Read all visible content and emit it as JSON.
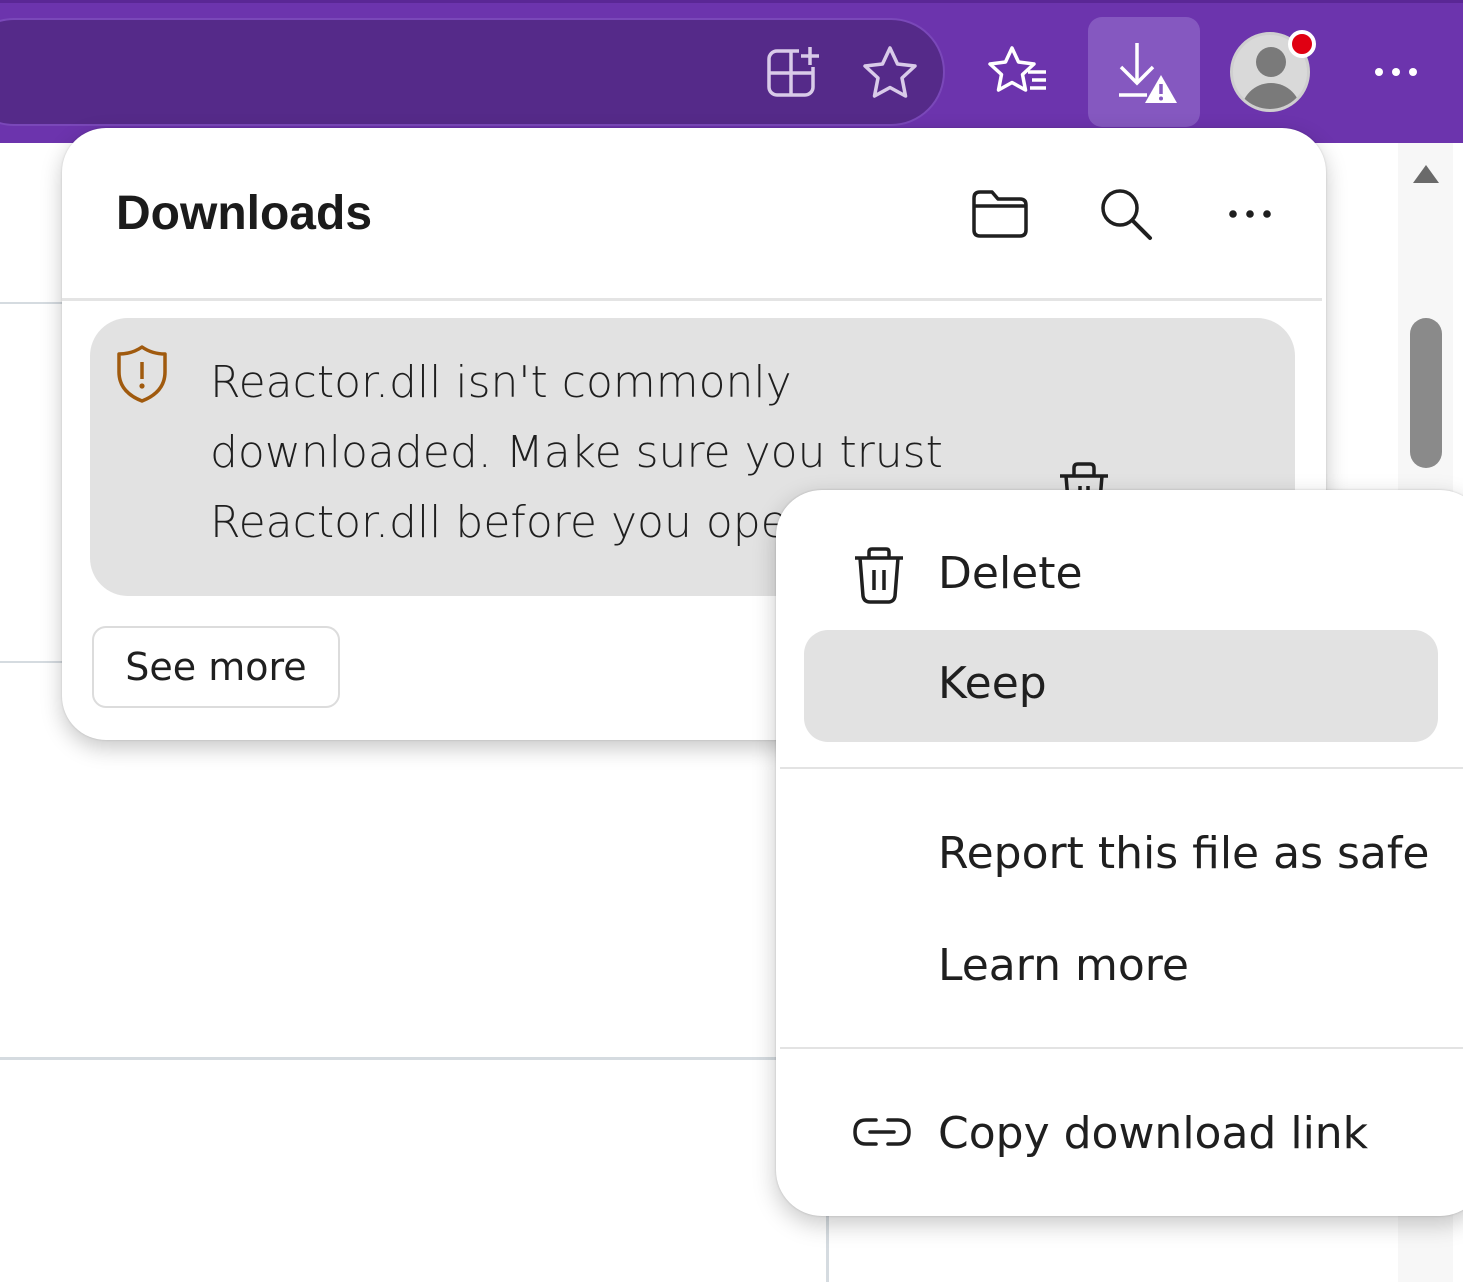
{
  "toolbar": {
    "address_icons": [
      "add-split-tab-icon",
      "favorite-star-icon"
    ],
    "favorites_icon": "favorites-list-icon",
    "downloads_icon": "download-warning-icon",
    "more_icon": "more-horizontal-icon",
    "colors": {
      "background": "#6c34ad",
      "address_bar": "#552a89",
      "active_button": "#8558c0"
    }
  },
  "downloads_panel": {
    "title": "Downloads",
    "header_icons": [
      "open-folder-icon",
      "search-icon",
      "more-horizontal-icon"
    ],
    "warning": {
      "icon": "shield-warning-icon",
      "line1": "Reactor.dll isn't commonly",
      "line2": "downloaded. Make sure you trust",
      "line3": "Reactor.dll before you ope"
    },
    "see_more_label": "See more"
  },
  "context_menu": {
    "items": [
      {
        "label": "Delete",
        "icon": "trash-icon"
      },
      {
        "label": "Keep",
        "icon": ""
      },
      {
        "label": "Report this file as safe",
        "icon": ""
      },
      {
        "label": "Learn more",
        "icon": ""
      },
      {
        "label": "Copy download link",
        "icon": "link-icon"
      }
    ],
    "hovered": "Keep"
  }
}
